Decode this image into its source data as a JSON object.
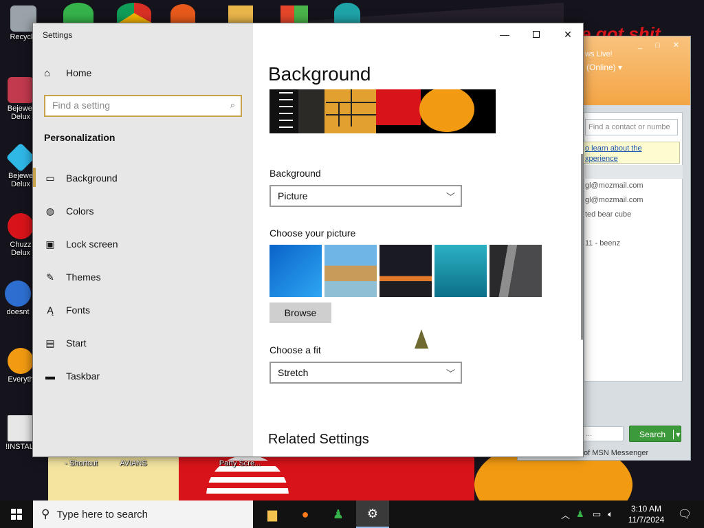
{
  "desktop": {
    "icons": [
      {
        "label": "Recycle",
        "color": "#9aa3a8"
      },
      {
        "label": "Bejewel\nDelux",
        "color": "#c23a4e"
      },
      {
        "label": "Bejewe\nDelux",
        "color": "#2fb7e6"
      },
      {
        "label": "Chuzz\nDelux",
        "color": "#d8141a"
      },
      {
        "label": "doesnt",
        "color": "#2d6fd1"
      },
      {
        "label": "Everyth",
        "color": "#f19a12"
      },
      {
        "label": "!INSTALI",
        "color": "#e7e7e7"
      },
      {
        "label": "- Shortcut",
        "color": "#e7e7e7"
      },
      {
        "label": "AVIANS",
        "color": "#e7e7e7"
      },
      {
        "label": "Party Scre...",
        "color": "#e7e7e7"
      }
    ]
  },
  "msn": {
    "user": "ws Live!",
    "status": "(Online) ▾",
    "find_placeholder": "Find a contact or numbe",
    "note": "o learn about the\nxperience",
    "contacts": [
      "gl@mozmail.com",
      "gl@mozmail.com",
      "ted bear cube",
      "11 - beenz"
    ],
    "search_field": "...",
    "search_button": "Search",
    "footer": "of MSN Messenger",
    "bg_text": "e got shit"
  },
  "settings": {
    "window_title": "Settings",
    "controls": {
      "minimize": "—",
      "close": "✕"
    },
    "home_label": "Home",
    "search_placeholder": "Find a setting",
    "section_label": "Personalization",
    "nav": [
      {
        "label": "Background",
        "icon": "picture-icon",
        "glyph": "▭"
      },
      {
        "label": "Colors",
        "icon": "palette-icon",
        "glyph": "◍"
      },
      {
        "label": "Lock screen",
        "icon": "lock-screen-icon",
        "glyph": "▣"
      },
      {
        "label": "Themes",
        "icon": "themes-icon",
        "glyph": "✎"
      },
      {
        "label": "Fonts",
        "icon": "fonts-icon",
        "glyph": "Ą"
      },
      {
        "label": "Start",
        "icon": "start-icon",
        "glyph": "▤"
      },
      {
        "label": "Taskbar",
        "icon": "taskbar-icon",
        "glyph": "▬"
      }
    ],
    "page_title": "Background",
    "background_label": "Background",
    "background_value": "Picture",
    "choose_picture_label": "Choose your picture",
    "pictures": [
      {
        "name": "windows-blue",
        "color": "#1e8fe6"
      },
      {
        "name": "beach-rocks",
        "color": "#6fa9c9"
      },
      {
        "name": "night-sky-tent",
        "color": "#25232a"
      },
      {
        "name": "underwater-swimmer",
        "color": "#1e9aa8"
      },
      {
        "name": "rock-cliff",
        "color": "#4d4d4f"
      }
    ],
    "browse_label": "Browse",
    "fit_label": "Choose a fit",
    "fit_value": "Stretch",
    "related_label": "Related Settings",
    "accent": "#c8a24a"
  },
  "taskbar": {
    "search_text": "Type here to search",
    "apps": [
      {
        "name": "file-explorer",
        "glyph": "▆",
        "color": "#f2c14e"
      },
      {
        "name": "firefox",
        "glyph": "●",
        "color": "#ff7a1a"
      },
      {
        "name": "msn-messenger",
        "glyph": "♟",
        "color": "#35b34a"
      },
      {
        "name": "settings",
        "glyph": "⚙",
        "color": "#ffffff"
      }
    ],
    "time": "3:10 AM",
    "date": "11/7/2024"
  }
}
